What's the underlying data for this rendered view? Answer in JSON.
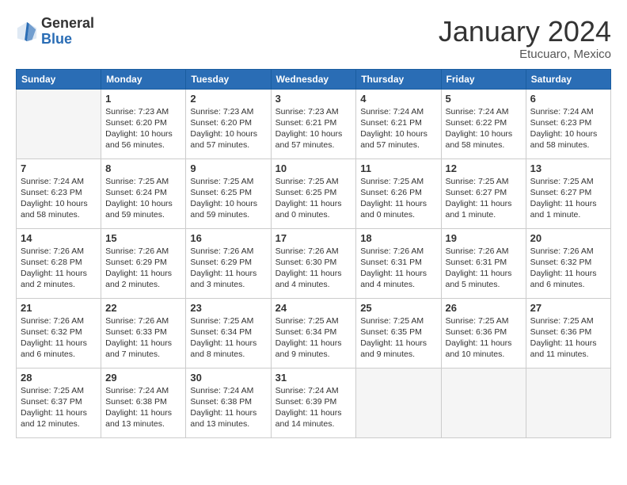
{
  "logo": {
    "general": "General",
    "blue": "Blue"
  },
  "title": "January 2024",
  "subtitle": "Etucuaro, Mexico",
  "days_of_week": [
    "Sunday",
    "Monday",
    "Tuesday",
    "Wednesday",
    "Thursday",
    "Friday",
    "Saturday"
  ],
  "weeks": [
    [
      {
        "day": "",
        "info": ""
      },
      {
        "day": "1",
        "info": "Sunrise: 7:23 AM\nSunset: 6:20 PM\nDaylight: 10 hours\nand 56 minutes."
      },
      {
        "day": "2",
        "info": "Sunrise: 7:23 AM\nSunset: 6:20 PM\nDaylight: 10 hours\nand 57 minutes."
      },
      {
        "day": "3",
        "info": "Sunrise: 7:23 AM\nSunset: 6:21 PM\nDaylight: 10 hours\nand 57 minutes."
      },
      {
        "day": "4",
        "info": "Sunrise: 7:24 AM\nSunset: 6:21 PM\nDaylight: 10 hours\nand 57 minutes."
      },
      {
        "day": "5",
        "info": "Sunrise: 7:24 AM\nSunset: 6:22 PM\nDaylight: 10 hours\nand 58 minutes."
      },
      {
        "day": "6",
        "info": "Sunrise: 7:24 AM\nSunset: 6:23 PM\nDaylight: 10 hours\nand 58 minutes."
      }
    ],
    [
      {
        "day": "7",
        "info": "Sunrise: 7:24 AM\nSunset: 6:23 PM\nDaylight: 10 hours\nand 58 minutes."
      },
      {
        "day": "8",
        "info": "Sunrise: 7:25 AM\nSunset: 6:24 PM\nDaylight: 10 hours\nand 59 minutes."
      },
      {
        "day": "9",
        "info": "Sunrise: 7:25 AM\nSunset: 6:25 PM\nDaylight: 10 hours\nand 59 minutes."
      },
      {
        "day": "10",
        "info": "Sunrise: 7:25 AM\nSunset: 6:25 PM\nDaylight: 11 hours\nand 0 minutes."
      },
      {
        "day": "11",
        "info": "Sunrise: 7:25 AM\nSunset: 6:26 PM\nDaylight: 11 hours\nand 0 minutes."
      },
      {
        "day": "12",
        "info": "Sunrise: 7:25 AM\nSunset: 6:27 PM\nDaylight: 11 hours\nand 1 minute."
      },
      {
        "day": "13",
        "info": "Sunrise: 7:25 AM\nSunset: 6:27 PM\nDaylight: 11 hours\nand 1 minute."
      }
    ],
    [
      {
        "day": "14",
        "info": "Sunrise: 7:26 AM\nSunset: 6:28 PM\nDaylight: 11 hours\nand 2 minutes."
      },
      {
        "day": "15",
        "info": "Sunrise: 7:26 AM\nSunset: 6:29 PM\nDaylight: 11 hours\nand 2 minutes."
      },
      {
        "day": "16",
        "info": "Sunrise: 7:26 AM\nSunset: 6:29 PM\nDaylight: 11 hours\nand 3 minutes."
      },
      {
        "day": "17",
        "info": "Sunrise: 7:26 AM\nSunset: 6:30 PM\nDaylight: 11 hours\nand 4 minutes."
      },
      {
        "day": "18",
        "info": "Sunrise: 7:26 AM\nSunset: 6:31 PM\nDaylight: 11 hours\nand 4 minutes."
      },
      {
        "day": "19",
        "info": "Sunrise: 7:26 AM\nSunset: 6:31 PM\nDaylight: 11 hours\nand 5 minutes."
      },
      {
        "day": "20",
        "info": "Sunrise: 7:26 AM\nSunset: 6:32 PM\nDaylight: 11 hours\nand 6 minutes."
      }
    ],
    [
      {
        "day": "21",
        "info": "Sunrise: 7:26 AM\nSunset: 6:32 PM\nDaylight: 11 hours\nand 6 minutes."
      },
      {
        "day": "22",
        "info": "Sunrise: 7:26 AM\nSunset: 6:33 PM\nDaylight: 11 hours\nand 7 minutes."
      },
      {
        "day": "23",
        "info": "Sunrise: 7:25 AM\nSunset: 6:34 PM\nDaylight: 11 hours\nand 8 minutes."
      },
      {
        "day": "24",
        "info": "Sunrise: 7:25 AM\nSunset: 6:34 PM\nDaylight: 11 hours\nand 9 minutes."
      },
      {
        "day": "25",
        "info": "Sunrise: 7:25 AM\nSunset: 6:35 PM\nDaylight: 11 hours\nand 9 minutes."
      },
      {
        "day": "26",
        "info": "Sunrise: 7:25 AM\nSunset: 6:36 PM\nDaylight: 11 hours\nand 10 minutes."
      },
      {
        "day": "27",
        "info": "Sunrise: 7:25 AM\nSunset: 6:36 PM\nDaylight: 11 hours\nand 11 minutes."
      }
    ],
    [
      {
        "day": "28",
        "info": "Sunrise: 7:25 AM\nSunset: 6:37 PM\nDaylight: 11 hours\nand 12 minutes."
      },
      {
        "day": "29",
        "info": "Sunrise: 7:24 AM\nSunset: 6:38 PM\nDaylight: 11 hours\nand 13 minutes."
      },
      {
        "day": "30",
        "info": "Sunrise: 7:24 AM\nSunset: 6:38 PM\nDaylight: 11 hours\nand 13 minutes."
      },
      {
        "day": "31",
        "info": "Sunrise: 7:24 AM\nSunset: 6:39 PM\nDaylight: 11 hours\nand 14 minutes."
      },
      {
        "day": "",
        "info": ""
      },
      {
        "day": "",
        "info": ""
      },
      {
        "day": "",
        "info": ""
      }
    ]
  ]
}
